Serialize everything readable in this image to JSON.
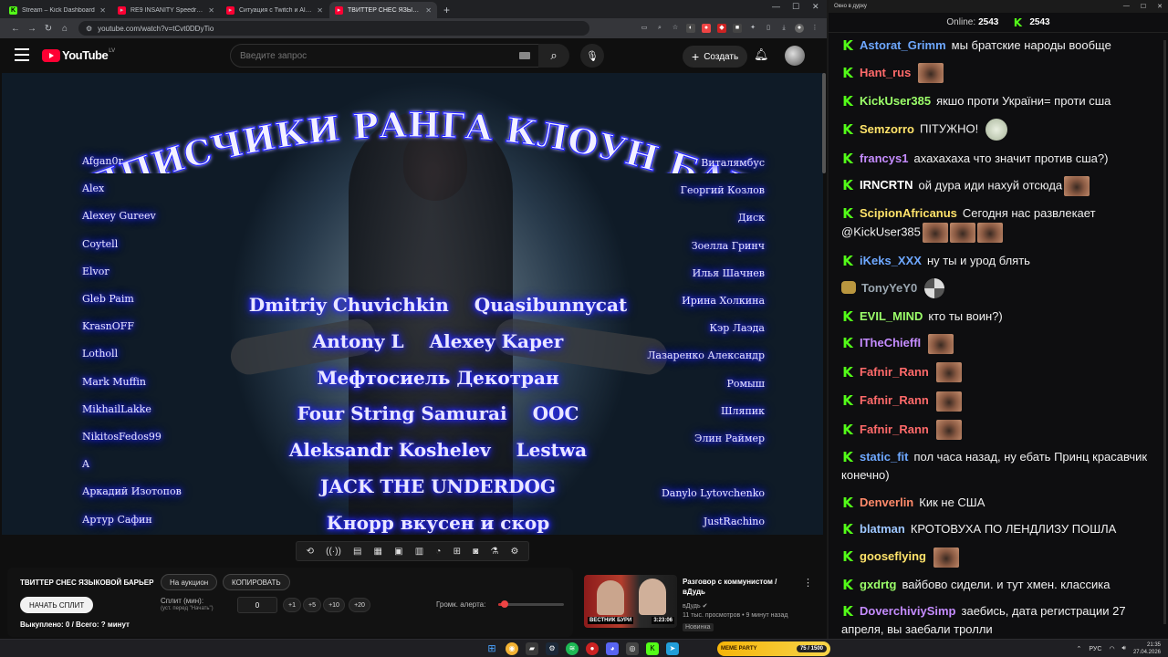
{
  "browser": {
    "tabs": [
      {
        "label": "Stream – Kick Dashboard",
        "icon": "kick-icon",
        "active": false
      },
      {
        "label": "RE9 INSANITY Speedrun in 5:3...",
        "icon": "youtube-icon",
        "active": false
      },
      {
        "label": "Ситуация с Twitch и Alabyrol...",
        "icon": "youtube-icon",
        "active": false
      },
      {
        "label": "ТВИТТЕР СНЕС ЯЗЫКОВОЙ БА...",
        "icon": "youtube-icon",
        "active": true
      }
    ],
    "url": "youtube.com/watch?v=tCvt0DDyTio"
  },
  "youtube": {
    "logo_text": "YouTube",
    "region": "LV",
    "search_placeholder": "Введите запрос",
    "create_label": "Создать"
  },
  "video": {
    "title_text": "ПОДПИСЧИКИ РАНГА КЛОУН БАГГИ",
    "left_names": [
      "Afgan0r",
      "Alex",
      "Alexey Gureev",
      "Coytell",
      "Elvor",
      "Gleb Paim",
      "KrasnOFF",
      "Lotholl",
      "Mark Muffin",
      "MikhailLakke",
      "NikitosFedos99",
      "A",
      "Аркадий Изотопов",
      "Артур Сафин"
    ],
    "right_names": [
      "Виталямбус",
      "Георгий Козлов",
      "Диск",
      "Зоелла Гринч",
      "Илья Шачнев",
      "Ирина Холкина",
      "Кэр Лаэда",
      "Лазаренко Александр",
      "Ромыш",
      "Шляпик",
      "Элин Раймер",
      "ᅠᅠᅠᅠ ᅠᅠᅠᅠᅠᅠᅠᅠ",
      "Danylo Lytovchenko",
      "JustRachino"
    ],
    "center_rows": [
      [
        "Dmitriy Chuvichkin",
        "Quasibunnycat"
      ],
      [
        "Antony L",
        "Alexey Kaper"
      ],
      [
        "Мефтосиель Декотран"
      ],
      [
        "Four String Samurai",
        "OOC"
      ],
      [
        "Aleksandr Koshelev",
        "Lestwa"
      ],
      [
        "JACK THE UNDERDOG"
      ],
      [
        "Кнорр вкусен и скор"
      ]
    ]
  },
  "toolbar": {
    "icons": [
      "loop-icon",
      "broadcast-icon",
      "camera-list-icon",
      "film-icon",
      "picture-in-picture-icon",
      "frames-icon",
      "speed-icon",
      "add-clip-icon",
      "screenshot-icon",
      "flask-icon",
      "settings-icon"
    ]
  },
  "panel": {
    "title": "ТВИТТЕР СНЕС ЯЗЫКОВОЙ БАРЬЕР",
    "auction_label": "На аукцион",
    "copy_label": "КОПИРОВАТЬ",
    "start_split_label": "НАЧАТЬ СПЛИТ",
    "split_label": "Сплит (мин):",
    "split_hint": "(уст. перед \"Начать\")",
    "split_value": "0",
    "steps": [
      "+1",
      "+5",
      "+10",
      "+20"
    ],
    "alert_label": "Громк. алерта:",
    "alert_volume": 0.1,
    "bought": "Выкуплено: 0 / Всего: ? минут"
  },
  "recommended": {
    "title": "Разговор с коммунистом / вДудь",
    "channel": "вДудь",
    "meta": "11 тыс. просмотров • 9 минут назад",
    "badge": "Новинка",
    "duration": "3:23:06",
    "thumb_label": "ВЕСТНИК БУРИ"
  },
  "chat": {
    "window_title": "Окно в дурку",
    "online_label": "Online:",
    "online_count": "2543",
    "viewer_count": "2543",
    "messages": [
      {
        "user": "Astorat_Grimm",
        "color": "#6ea8ff",
        "text": "мы братские народы вообще",
        "emotes": 0,
        "badge": "kick"
      },
      {
        "user": "Hant_rus",
        "color": "#ff6a6a",
        "text": "",
        "emotes": 1,
        "badge": "kick"
      },
      {
        "user": "KickUser385",
        "color": "#9cff6a",
        "text": "якшо проти України= проти сша",
        "emotes": 0,
        "badge": "kick"
      },
      {
        "user": "Semzorro",
        "color": "#ffe36a",
        "text": "ПІТУЖНО!",
        "emotes": 0,
        "frog": true,
        "badge": "kick"
      },
      {
        "user": "francys1",
        "color": "#c58cff",
        "text": "ахахахаха что значит против сша?)",
        "emotes": 0,
        "badge": "kick"
      },
      {
        "user": "IRNCRTN",
        "color": "#ffffff",
        "text": "ой дура иди нахуй отсюда",
        "emotes": 1,
        "badge": "kick"
      },
      {
        "user": "ScipionAfricanus",
        "color": "#ffe36a",
        "text": "Сегодня нас развлекает @KickUser385",
        "emotes": 3,
        "badge": "kick"
      },
      {
        "user": "iKeks_XXX",
        "color": "#6ea8ff",
        "text": "ну ты и урод блять",
        "emotes": 0,
        "badge": "kick"
      },
      {
        "user": "TonyYeY0",
        "color": "#9aa6b0",
        "text": "",
        "emotes": 0,
        "spin": true,
        "badge": "dog"
      },
      {
        "user": "EVIL_MIND",
        "color": "#9cff6a",
        "text": "кто ты воин?)",
        "emotes": 0,
        "badge": "kick"
      },
      {
        "user": "ITheChieffI",
        "color": "#c58cff",
        "text": "",
        "emotes": 1,
        "badge": "kick"
      },
      {
        "user": "Fafnir_Rann",
        "color": "#ff6a6a",
        "text": "",
        "emotes": 1,
        "badge": "kick"
      },
      {
        "user": "Fafnir_Rann",
        "color": "#ff6a6a",
        "text": "",
        "emotes": 1,
        "badge": "kick"
      },
      {
        "user": "Fafnir_Rann",
        "color": "#ff6a6a",
        "text": "",
        "emotes": 1,
        "badge": "kick"
      },
      {
        "user": "static_fit",
        "color": "#6ea8ff",
        "text": "пол часа назад, ну ебать Принц красавчик конечно)",
        "emotes": 0,
        "badge": "kick"
      },
      {
        "user": "Denverlin",
        "color": "#ff8a6a",
        "text": "Кик не США",
        "emotes": 0,
        "badge": "kick"
      },
      {
        "user": "blatman",
        "color": "#9ec7ff",
        "text": "КРОТОВУХА ПО ЛЕНДЛИЗУ ПОШЛА",
        "emotes": 0,
        "badge": "kick"
      },
      {
        "user": "gooseflying",
        "color": "#ffe36a",
        "text": "",
        "emotes": 1,
        "badge": "kick"
      },
      {
        "user": "gxdrtg",
        "color": "#9cff6a",
        "text": "вайбово сидели. и тут хмен. классика",
        "emotes": 0,
        "badge": "kick"
      },
      {
        "user": "DoverchiviySimp",
        "color": "#c58cff",
        "text": "заебись, дата регистрации 27 апреля, вы заебали тролли",
        "emotes": 0,
        "badge": "kick"
      }
    ]
  },
  "taskbar": {
    "memes_label": "MEME PARTY",
    "memes_count": "75 / 1500",
    "lang": "РУС",
    "time": "21:35",
    "date": "27.04.2026"
  },
  "colors": {
    "kick_green": "#53fc18",
    "youtube_red": "#ff0033"
  }
}
